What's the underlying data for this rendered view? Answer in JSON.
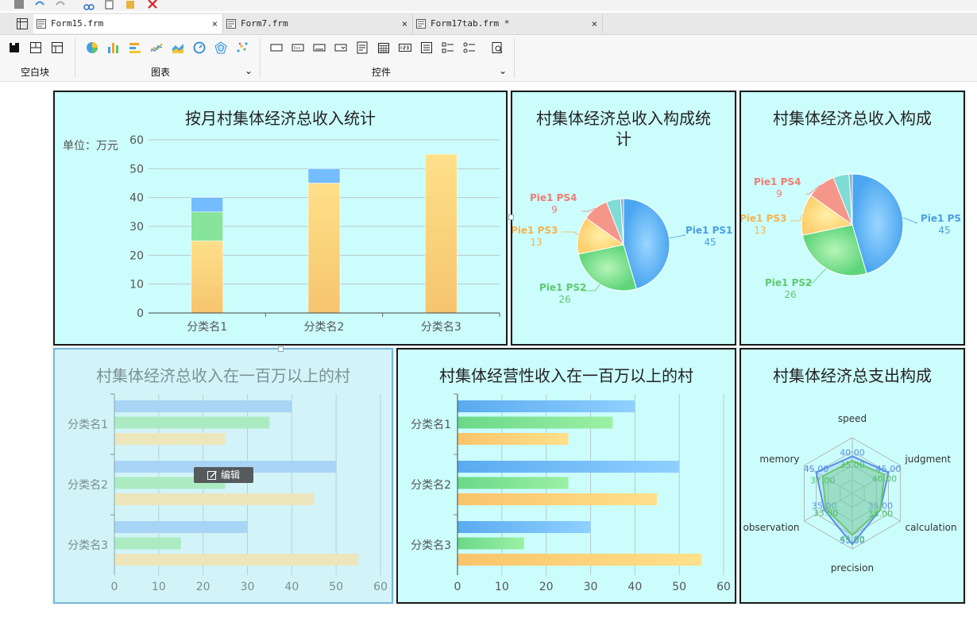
{
  "tabs": [
    {
      "label": "Form15.frm",
      "close": "×"
    },
    {
      "label": "Form7.frm",
      "close": "×"
    },
    {
      "label": "Form17tab.frm *",
      "close": "×"
    }
  ],
  "ribbon": {
    "groups": [
      {
        "label": "空白块"
      },
      {
        "label": "图表",
        "expand": "⌄"
      },
      {
        "label": "控件",
        "expand": "⌄"
      }
    ]
  },
  "colors": {
    "panel_bg": "#ccfdfd",
    "blue": "#73bcff",
    "green": "#86e59a",
    "yellow": "#ffd47a",
    "salmon": "#f4968a",
    "teal": "#7fdcd7"
  },
  "edit_badge": {
    "label": "编辑",
    "icon": "edit-icon"
  },
  "chart_data": [
    {
      "type": "bar",
      "stacked": true,
      "title": "按月村集体经济总收入统计",
      "unit": "单位：万元",
      "categories": [
        "分类名1",
        "分类名2",
        "分类名3"
      ],
      "series": [
        {
          "values": [
            25,
            45,
            55
          ]
        },
        {
          "values": [
            10,
            0,
            0
          ]
        },
        {
          "values": [
            5,
            5,
            0
          ]
        }
      ],
      "ylim": [
        0,
        60
      ],
      "yticks": [
        "0",
        "10",
        "20",
        "30",
        "40",
        "50",
        "60"
      ],
      "grid": true
    },
    {
      "type": "pie",
      "title": "村集体经济总收入构成统计",
      "slices": [
        {
          "name": "Pie1 PS1",
          "value": 45
        },
        {
          "name": "Pie1 PS2",
          "value": 26
        },
        {
          "name": "Pie1 PS3",
          "value": 13
        },
        {
          "name": "Pie1 PS4",
          "value": 9
        },
        {
          "name": "",
          "value": 5
        },
        {
          "name": "",
          "value": 1
        }
      ]
    },
    {
      "type": "pie",
      "title": "村集体经济总收入构成",
      "slices": [
        {
          "name": "Pie1 PS",
          "value": 45
        },
        {
          "name": "Pie1 PS2",
          "value": 26
        },
        {
          "name": "Pie1 PS3",
          "value": 13
        },
        {
          "name": "Pie1 PS4",
          "value": 9
        },
        {
          "name": "",
          "value": 5
        },
        {
          "name": "",
          "value": 1
        }
      ]
    },
    {
      "type": "bar",
      "orientation": "horizontal",
      "title": "村集体经济总收入在一百万以上的村",
      "categories": [
        "分类名1",
        "分类名2",
        "分类名3"
      ],
      "series": [
        {
          "values": [
            40,
            50,
            30
          ]
        },
        {
          "values": [
            35,
            25,
            15
          ]
        },
        {
          "values": [
            25,
            45,
            55
          ]
        }
      ],
      "xlim": [
        0,
        60
      ],
      "xticks": [
        "0",
        "10",
        "20",
        "30",
        "40",
        "50",
        "60"
      ],
      "grid": true
    },
    {
      "type": "bar",
      "orientation": "horizontal",
      "title": "村集体经营性收入在一百万以上的村",
      "categories": [
        "分类名1",
        "分类名2",
        "分类名3"
      ],
      "series": [
        {
          "values": [
            40,
            50,
            30
          ]
        },
        {
          "values": [
            35,
            25,
            15
          ]
        },
        {
          "values": [
            25,
            45,
            55
          ]
        }
      ],
      "xlim": [
        0,
        60
      ],
      "xticks": [
        "0",
        "10",
        "20",
        "30",
        "40",
        "50",
        "60"
      ],
      "grid": true
    },
    {
      "type": "radar",
      "title": "村集体经济总支出构成",
      "axes": [
        "speed",
        "judgment",
        "calculation",
        "precision",
        "observation",
        "memory"
      ],
      "max": 60,
      "series": [
        {
          "values": [
            40,
            45,
            35,
            55,
            35,
            45
          ],
          "labels": [
            "40.00",
            "45.00",
            "35.00",
            "55.00",
            "35.00",
            "45.00"
          ]
        },
        {
          "values": [
            35,
            40,
            35,
            45,
            33,
            37
          ],
          "labels": [
            "35.00",
            "40.00",
            "35.00",
            "45.00",
            "33.00",
            "37.00"
          ]
        }
      ]
    }
  ]
}
